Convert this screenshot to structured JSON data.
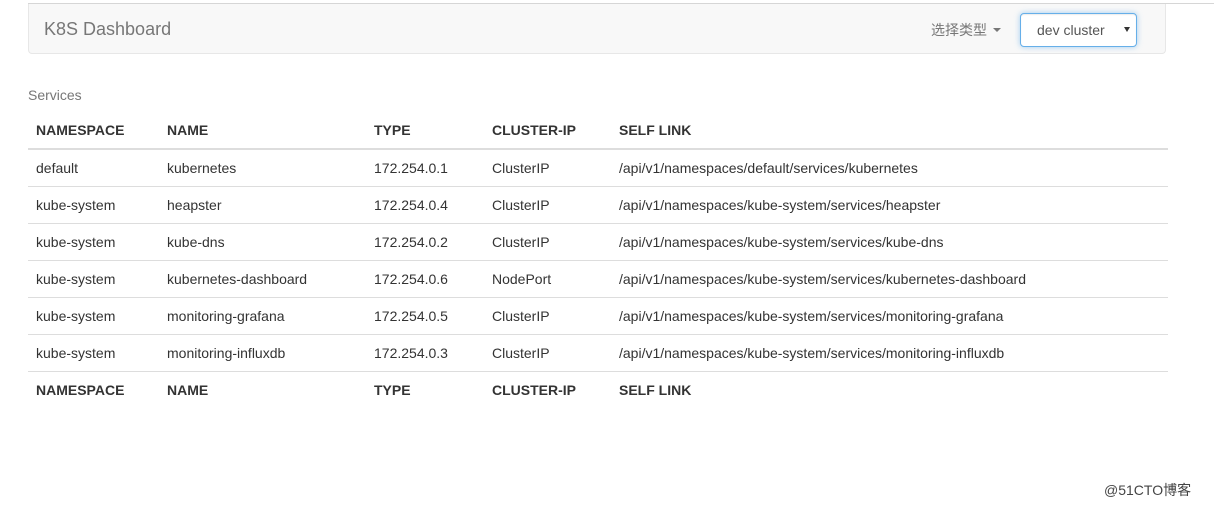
{
  "navbar": {
    "brand": "K8S Dashboard",
    "type_dropdown_label": "选择类型",
    "cluster_select_value": "dev cluster"
  },
  "table": {
    "caption": "Services",
    "columns": [
      "NAMESPACE",
      "NAME",
      "TYPE",
      "CLUSTER-IP",
      "SELF LINK"
    ],
    "rows": [
      [
        "default",
        "kubernetes",
        "172.254.0.1",
        "ClusterIP",
        "/api/v1/namespaces/default/services/kubernetes"
      ],
      [
        "kube-system",
        "heapster",
        "172.254.0.4",
        "ClusterIP",
        "/api/v1/namespaces/kube-system/services/heapster"
      ],
      [
        "kube-system",
        "kube-dns",
        "172.254.0.2",
        "ClusterIP",
        "/api/v1/namespaces/kube-system/services/kube-dns"
      ],
      [
        "kube-system",
        "kubernetes-dashboard",
        "172.254.0.6",
        "NodePort",
        "/api/v1/namespaces/kube-system/services/kubernetes-dashboard"
      ],
      [
        "kube-system",
        "monitoring-grafana",
        "172.254.0.5",
        "ClusterIP",
        "/api/v1/namespaces/kube-system/services/monitoring-grafana"
      ],
      [
        "kube-system",
        "monitoring-influxdb",
        "172.254.0.3",
        "ClusterIP",
        "/api/v1/namespaces/kube-system/services/monitoring-influxdb"
      ]
    ]
  },
  "watermark": "@51CTO博客"
}
